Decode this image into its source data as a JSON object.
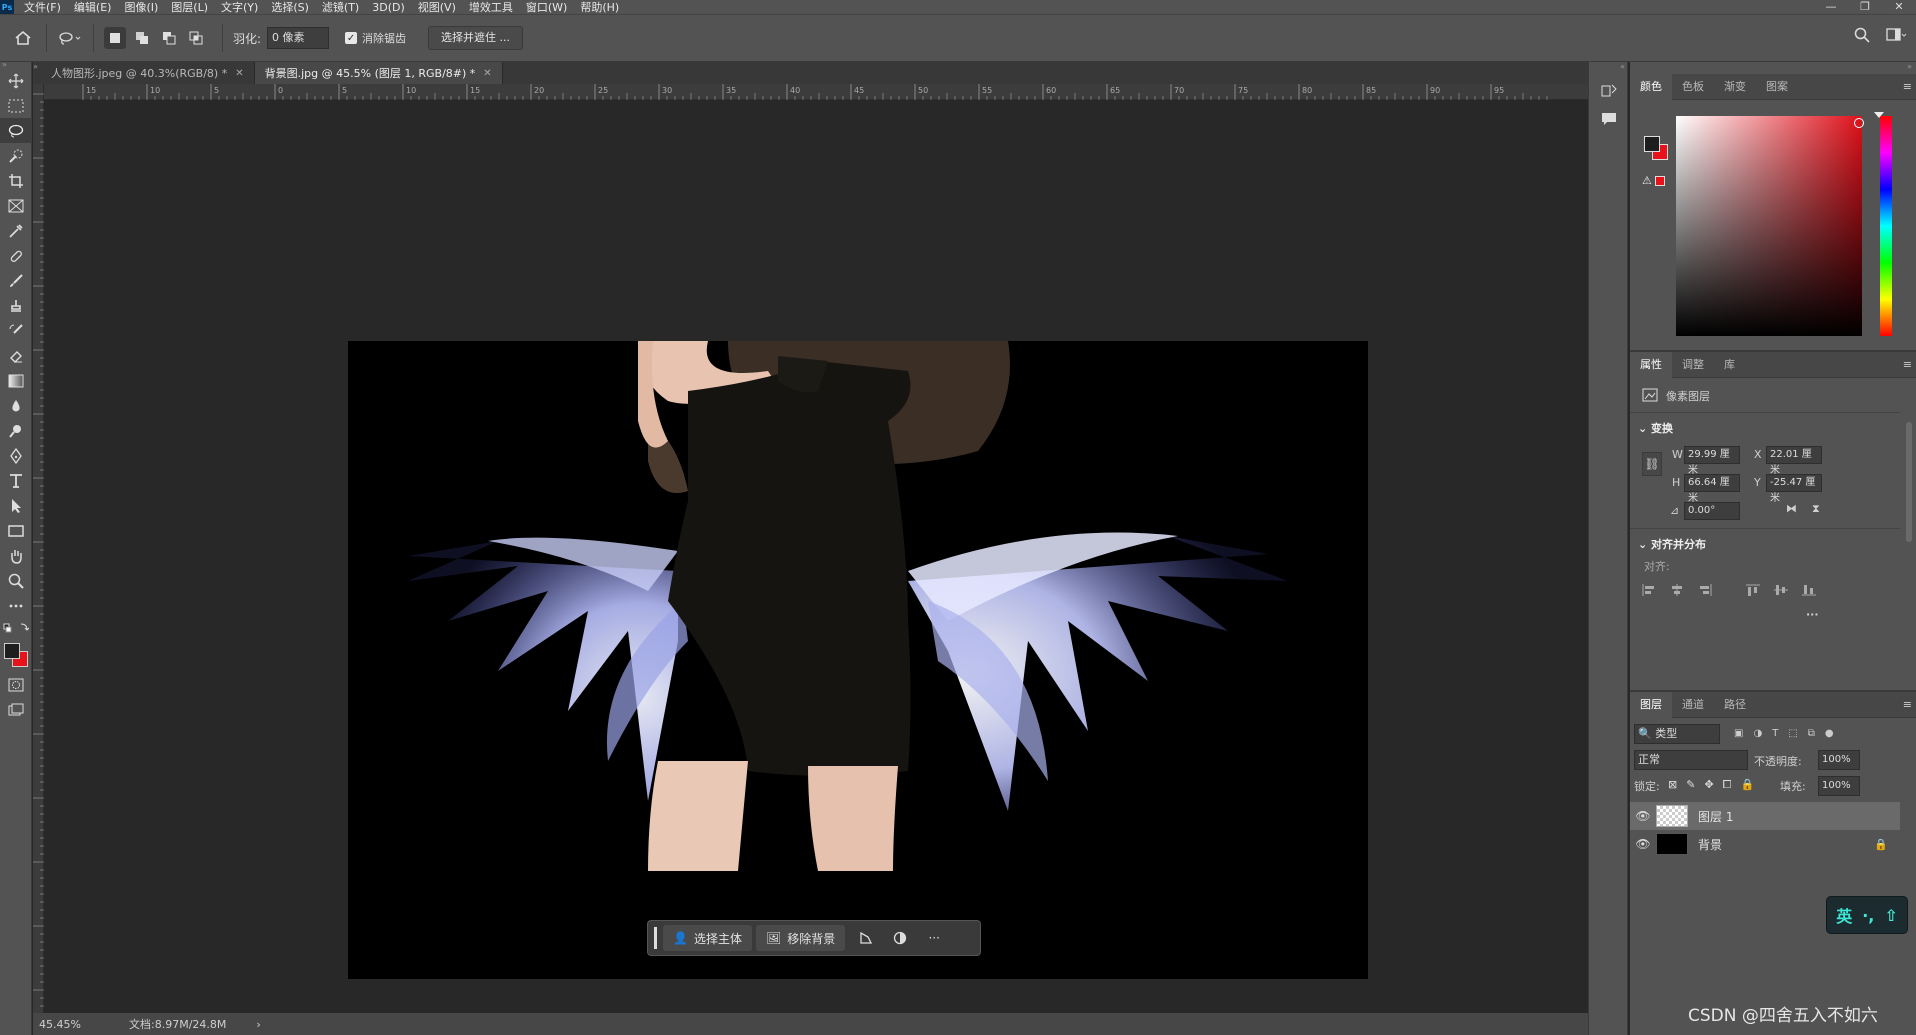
{
  "app": {
    "logo": "Ps"
  },
  "menu": [
    "文件(F)",
    "编辑(E)",
    "图像(I)",
    "图层(L)",
    "文字(Y)",
    "选择(S)",
    "滤镜(T)",
    "3D(D)",
    "视图(V)",
    "增效工具",
    "窗口(W)",
    "帮助(H)"
  ],
  "window_controls": {
    "minimize": "—",
    "restore": "❐",
    "close": "✕"
  },
  "options": {
    "feather_label": "羽化:",
    "feather_value": "0 像素",
    "antialias_label": "消除锯齿",
    "antialias_checked": true,
    "select_mask_label": "选择并遮住 ..."
  },
  "tabs": [
    {
      "label": "人物图形.jpeg @ 40.3%(RGB/8) *",
      "active": false
    },
    {
      "label": "背景图.jpg @ 45.5% (图层 1, RGB/8#) *",
      "active": true
    }
  ],
  "ruler_ticks": [
    "15",
    "10",
    "5",
    "0",
    "5",
    "10",
    "15",
    "20",
    "25",
    "30",
    "35",
    "40",
    "45",
    "50",
    "55",
    "60",
    "65",
    "70",
    "75",
    "80",
    "85",
    "90",
    "95"
  ],
  "context_bar": {
    "select_subject": "选择主体",
    "remove_bg": "移除背景",
    "more": "···"
  },
  "status": {
    "zoom": "45.45%",
    "doc": "文档:8.97M/24.8M",
    "arrow": "›"
  },
  "color_panel": {
    "tabs": [
      "颜色",
      "色板",
      "渐变",
      "图案"
    ],
    "foreground": "#1e1e1e",
    "background": "#e8121a"
  },
  "properties": {
    "tabs": [
      "属性",
      "调整",
      "库"
    ],
    "layer_type": "像素图层",
    "transform_title": "变换",
    "w_label": "W",
    "w": "29.99 厘米",
    "x_label": "X",
    "x": "22.01 厘米",
    "h_label": "H",
    "h": "66.64 厘米",
    "y_label": "Y",
    "y": "-25.47 厘米",
    "angle": "0.00°",
    "align_title": "对齐并分布",
    "align_label": "对齐:",
    "more": "···"
  },
  "layers": {
    "tabs": [
      "图层",
      "通道",
      "路径"
    ],
    "filter": "类型",
    "blend_mode": "正常",
    "opacity_label": "不透明度:",
    "opacity": "100%",
    "lock_label": "锁定:",
    "fill_label": "填充:",
    "fill": "100%",
    "items": [
      {
        "name": "图层 1",
        "active": true
      },
      {
        "name": "背景",
        "active": false
      }
    ]
  },
  "ime": {
    "lang": "英",
    "punct": "·,",
    "skin": "⇧"
  },
  "watermark": "CSDN @四舍五入不如六"
}
